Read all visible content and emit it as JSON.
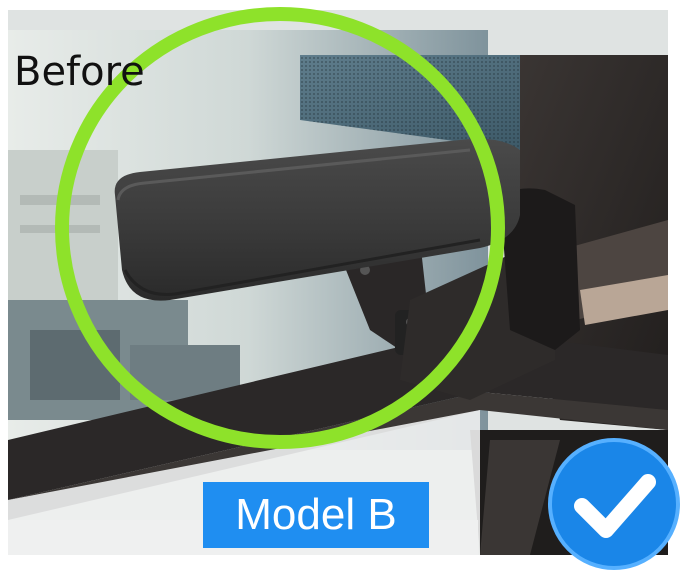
{
  "before_label": "Before",
  "model_label": "Model B",
  "colors": {
    "highlight_ring": "#8ee22a",
    "badge_blue": "#1f8ef1",
    "check_blue": "#1a86e8",
    "check_mark": "#ffffff",
    "windshield_tint": "#4a6f80",
    "mirror_body": "#3e3e3e"
  },
  "icons": {
    "check": "checkmark-icon"
  }
}
